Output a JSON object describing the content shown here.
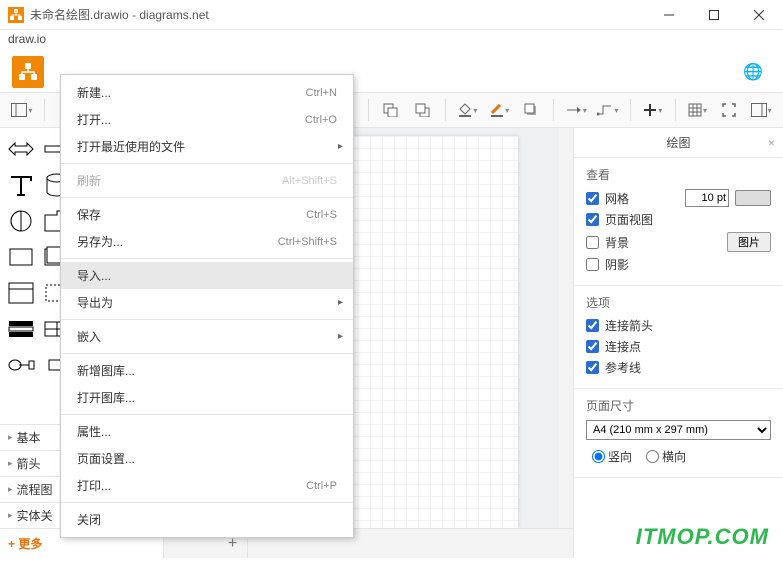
{
  "window": {
    "title": "未命名绘图.drawio - diagrams.net",
    "menubar_label": "draw.io"
  },
  "file_menu": {
    "new": "新建...",
    "new_sc": "Ctrl+N",
    "open": "打开...",
    "open_sc": "Ctrl+O",
    "recent": "打开最近使用的文件",
    "refresh": "刷新",
    "refresh_sc": "Alt+Shift+S",
    "save": "保存",
    "save_sc": "Ctrl+S",
    "saveas": "另存为...",
    "saveas_sc": "Ctrl+Shift+S",
    "import": "导入...",
    "export": "导出为",
    "embed": "嵌入",
    "newlib": "新增图库...",
    "openlib": "打开图库...",
    "props": "属性...",
    "pagesetup": "页面设置...",
    "print": "打印...",
    "print_sc": "Ctrl+P",
    "close": "关闭"
  },
  "categories": [
    "基本",
    "箭头",
    "流程图",
    "实体关"
  ],
  "more_shapes": "+ 更多",
  "right": {
    "header": "绘图",
    "view": "查看",
    "grid": "网格",
    "grid_val": "10 pt",
    "pageview": "页面视图",
    "background": "背景",
    "pic_btn": "图片",
    "shadow": "阴影",
    "options": "选项",
    "conn_arrow": "连接箭头",
    "conn_point": "连接点",
    "guides": "参考线",
    "page_size": "页面尺寸",
    "page_sel": "A4 (210 mm x 297 mm)",
    "portrait": "竖向",
    "landscape": "横向"
  },
  "watermark": "ITMOP.COM"
}
